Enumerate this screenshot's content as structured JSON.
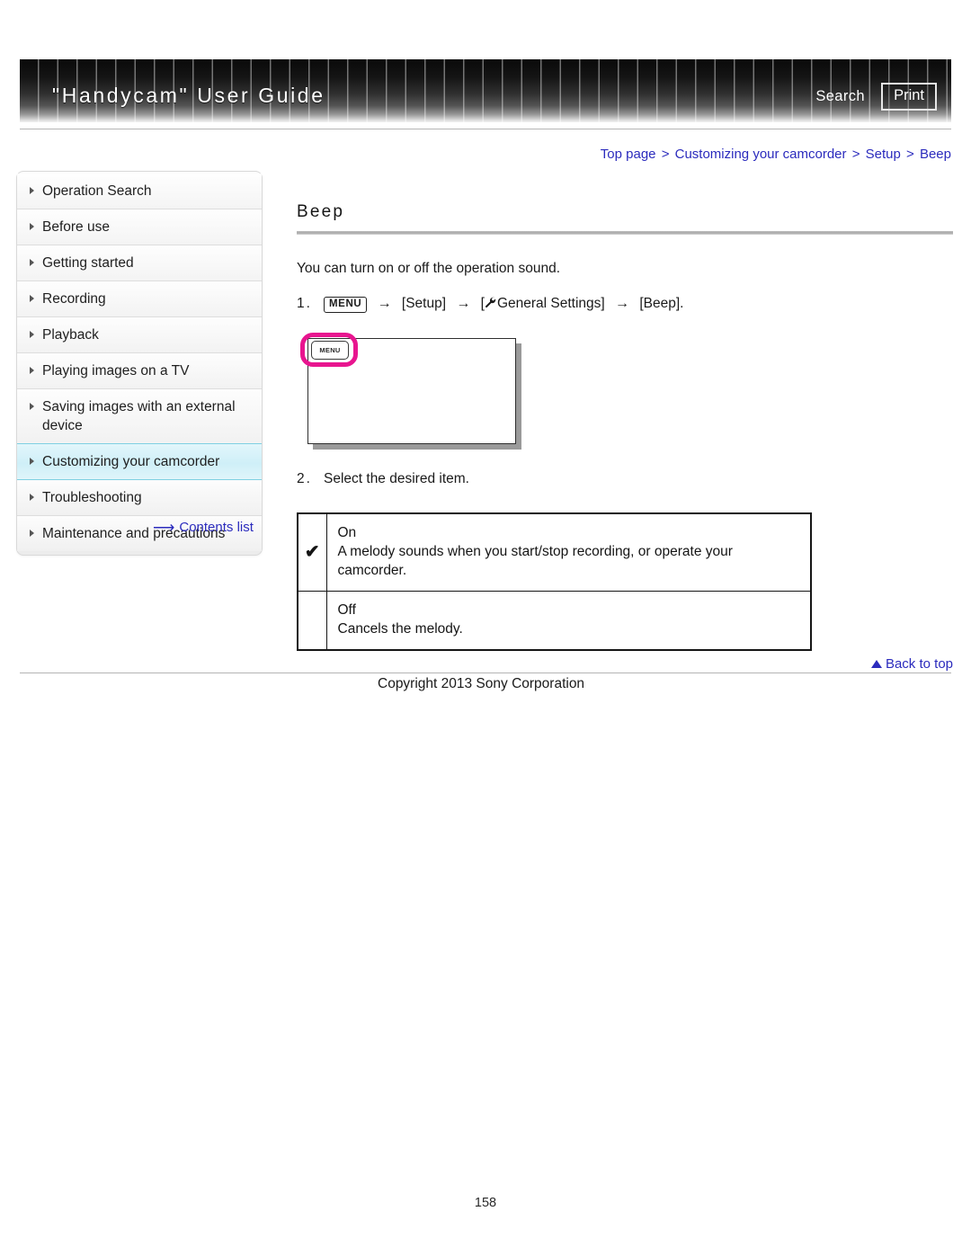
{
  "header": {
    "title": "\"Handycam\" User Guide",
    "search_label": "Search",
    "print_label": "Print"
  },
  "breadcrumb": {
    "items": [
      "Top page",
      "Customizing your camcorder",
      "Setup",
      "Beep"
    ],
    "separator": ">"
  },
  "sidebar": {
    "items": [
      {
        "label": "Operation Search",
        "active": false
      },
      {
        "label": "Before use",
        "active": false
      },
      {
        "label": "Getting started",
        "active": false
      },
      {
        "label": "Recording",
        "active": false
      },
      {
        "label": "Playback",
        "active": false
      },
      {
        "label": "Playing images on a TV",
        "active": false
      },
      {
        "label": "Saving images with an external device",
        "active": false
      },
      {
        "label": "Customizing your camcorder",
        "active": true
      },
      {
        "label": "Troubleshooting",
        "active": false
      },
      {
        "label": "Maintenance and precautions",
        "active": false
      }
    ],
    "contents_list_label": "Contents list",
    "contents_list_icon": "right-arrow-icon",
    "active_color": "#cfeff8",
    "active_border_color": "#7fd0e2"
  },
  "main": {
    "title": "Beep",
    "intro": "You can turn on or off the operation sound.",
    "step1": {
      "number": "1.",
      "menu_chip": "MENU",
      "arrow": "→",
      "part_setup": "[Setup]",
      "wrench_icon": "wrench-icon",
      "part_general": "General Settings]",
      "bracket_open": "[",
      "part_beep": "[Beep]."
    },
    "figure": {
      "screen_menu_label": "MENU",
      "highlight_color": "#e8158f"
    },
    "step2": {
      "number": "2.",
      "text": "Select the desired item."
    },
    "options": [
      {
        "mark": "✔",
        "name": "On",
        "description": "A melody sounds when you start/stop recording, or operate your camcorder."
      },
      {
        "mark": "",
        "name": "Off",
        "description": "Cancels the melody."
      }
    ]
  },
  "footer": {
    "back_to_top_label": "Back to top",
    "back_to_top_icon": "triangle-up-icon",
    "copyright": "Copyright 2013 Sony Corporation",
    "page_number": "158"
  }
}
